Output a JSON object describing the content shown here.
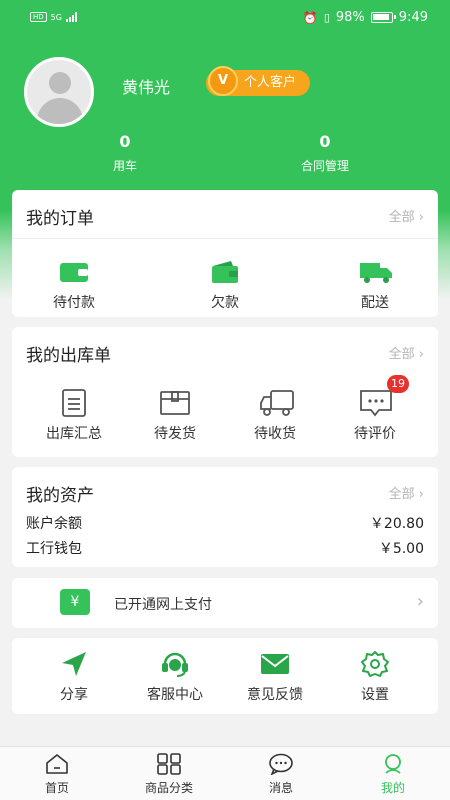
{
  "status_bar": {
    "hd": "HD",
    "network": "5G",
    "battery": "98%",
    "time": "9:49"
  },
  "profile": {
    "name": "黄伟光",
    "badge_letter": "V",
    "badge_label": "个人客户"
  },
  "stats": [
    {
      "value": "0",
      "label": "用车"
    },
    {
      "value": "0",
      "label": "合同管理"
    }
  ],
  "orders": {
    "title": "我的订单",
    "more": "全部",
    "items": [
      {
        "label": "待付款",
        "icon": "wallet-icon"
      },
      {
        "label": "欠款",
        "icon": "wallet-open-icon"
      },
      {
        "label": "配送",
        "icon": "truck-icon"
      }
    ]
  },
  "outbound": {
    "title": "我的出库单",
    "more": "全部",
    "items": [
      {
        "label": "出库汇总",
        "icon": "document-icon"
      },
      {
        "label": "待发货",
        "icon": "box-icon"
      },
      {
        "label": "待收货",
        "icon": "truck-outline-icon"
      },
      {
        "label": "待评价",
        "icon": "comment-icon",
        "badge": "19"
      }
    ]
  },
  "assets": {
    "title": "我的资产",
    "more": "全部",
    "rows": [
      {
        "label": "账户余额",
        "value": "￥20.80"
      },
      {
        "label": "工行钱包",
        "value": "￥5.00"
      }
    ]
  },
  "payment": {
    "label": "已开通网上支付",
    "icon_text": "¥"
  },
  "tools": [
    {
      "label": "分享",
      "icon": "send-icon"
    },
    {
      "label": "客服中心",
      "icon": "headset-icon"
    },
    {
      "label": "意见反馈",
      "icon": "mail-icon"
    },
    {
      "label": "设置",
      "icon": "gear-icon"
    }
  ],
  "tabbar": [
    {
      "label": "首页",
      "icon": "home-icon"
    },
    {
      "label": "商品分类",
      "icon": "category-icon"
    },
    {
      "label": "消息",
      "icon": "message-icon"
    },
    {
      "label": "我的",
      "icon": "user-icon",
      "active": true
    }
  ],
  "colors": {
    "primary": "#35c25a",
    "badge": "#f6a51d",
    "notify": "#e8312f"
  }
}
